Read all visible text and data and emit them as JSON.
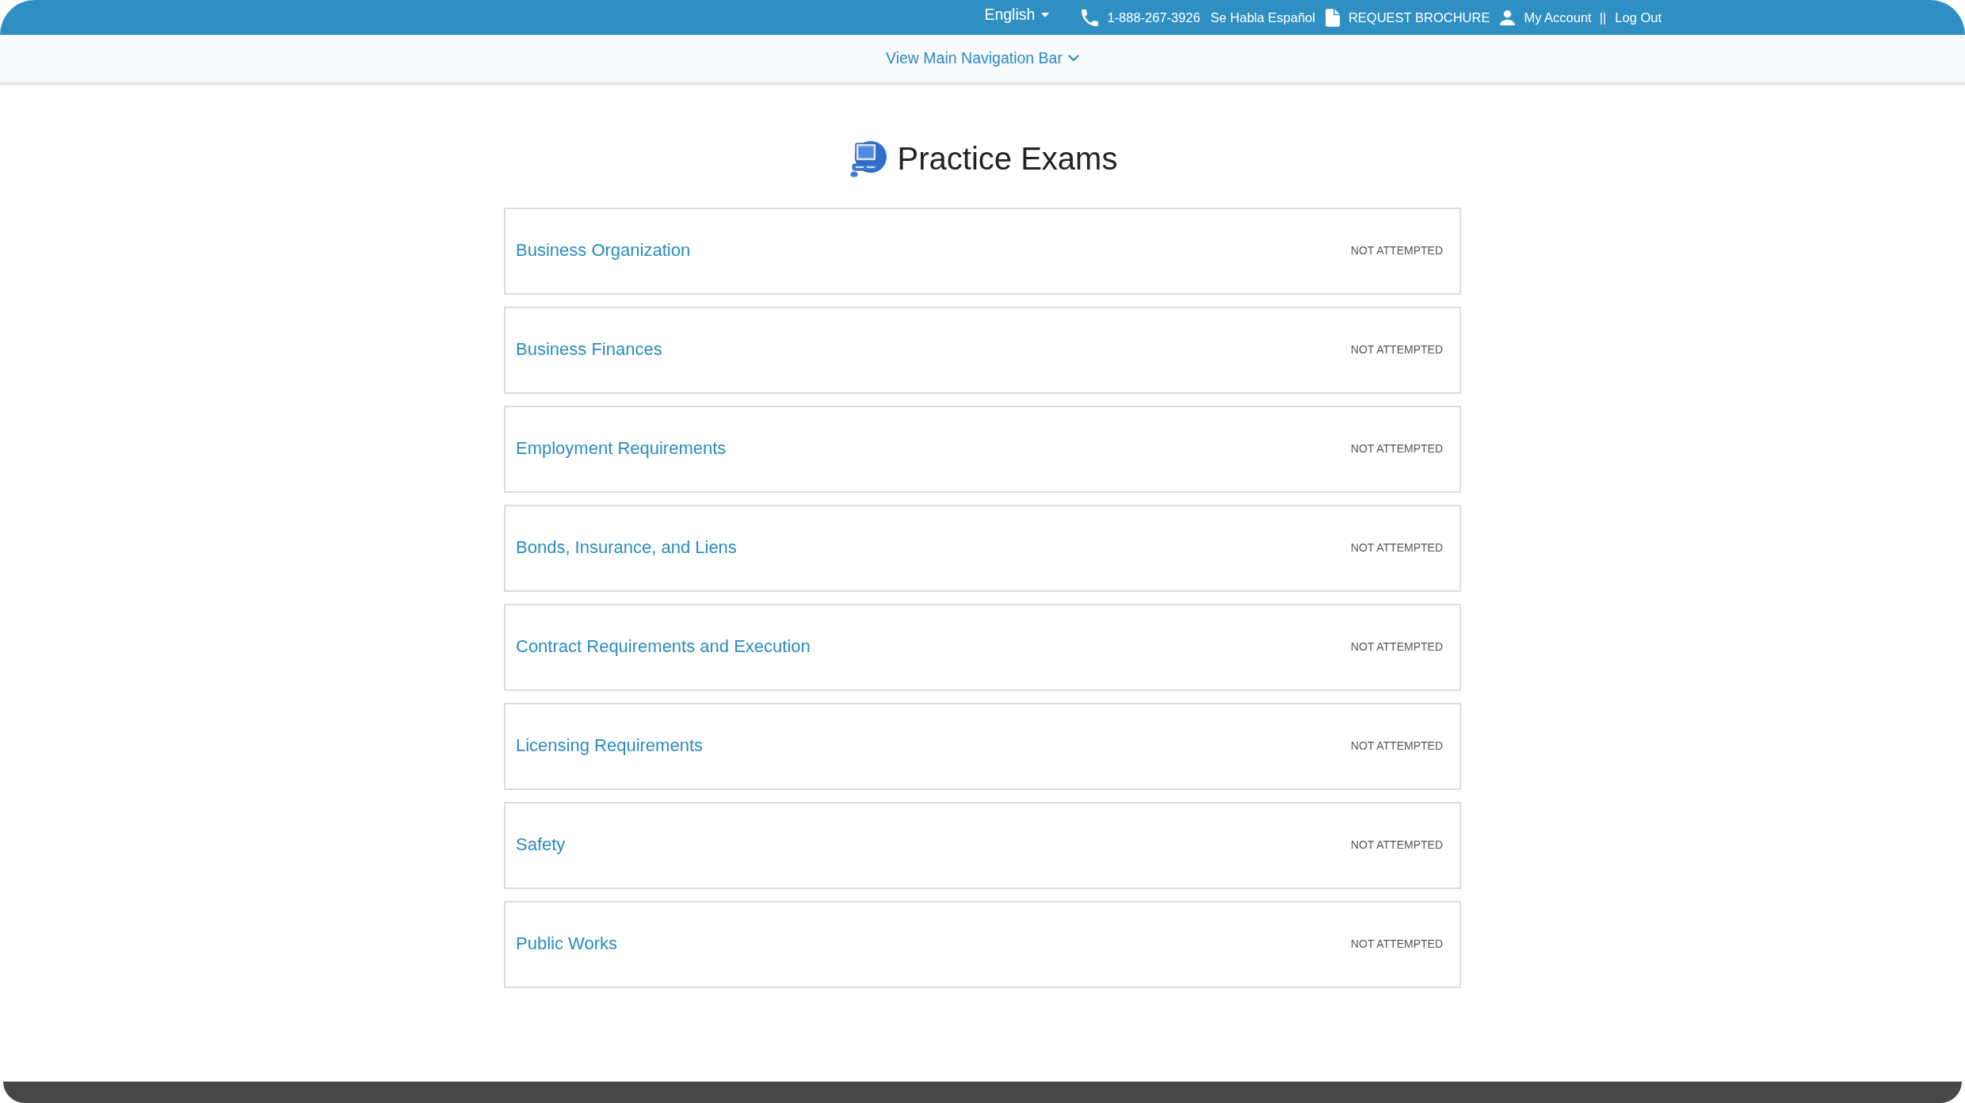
{
  "top_bar": {
    "items": [
      {
        "kind": "language",
        "label": "English"
      },
      {
        "kind": "phone",
        "label": "1-888-267-3926"
      },
      {
        "kind": "note",
        "label": "Se Habla Español"
      },
      {
        "kind": "brochure",
        "label": "REQUEST BROCHURE"
      },
      {
        "kind": "account",
        "label": "My Account"
      },
      {
        "kind": "separator",
        "label": "||"
      },
      {
        "kind": "logout",
        "label": "Log Out"
      }
    ]
  },
  "nav_toggle": {
    "label": "View Main Navigation Bar"
  },
  "page": {
    "title": "Practice Exams"
  },
  "exams": [
    {
      "title": "Business Organization",
      "status": "NOT ATTEMPTED"
    },
    {
      "title": "Business Finances",
      "status": "NOT ATTEMPTED"
    },
    {
      "title": "Employment Requirements",
      "status": "NOT ATTEMPTED"
    },
    {
      "title": "Bonds, Insurance, and Liens",
      "status": "NOT ATTEMPTED"
    },
    {
      "title": "Contract Requirements and Execution",
      "status": "NOT ATTEMPTED"
    },
    {
      "title": "Licensing Requirements",
      "status": "NOT ATTEMPTED"
    },
    {
      "title": "Safety",
      "status": "NOT ATTEMPTED"
    },
    {
      "title": "Public Works",
      "status": "NOT ATTEMPTED"
    }
  ]
}
